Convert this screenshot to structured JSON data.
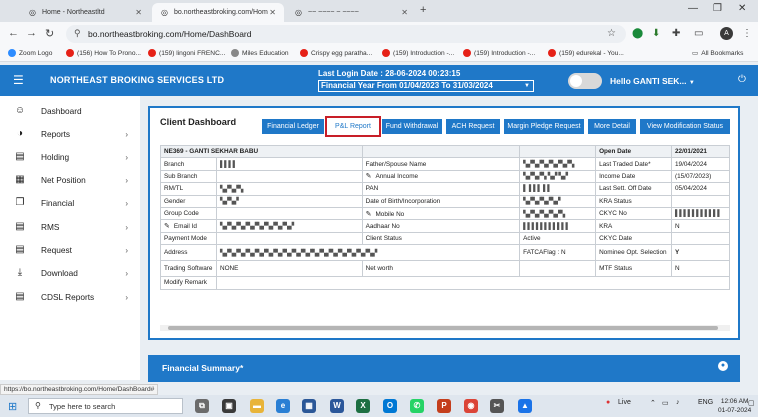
{
  "browser": {
    "tabs": [
      {
        "title": "Home - Northeastltd",
        "active": false
      },
      {
        "title": "bo.northeastbroking.com/Hom",
        "active": true
      },
      {
        "title": "~~ ~~~~ ~ ~~~~",
        "active": false
      }
    ],
    "url": "bo.northeastbroking.com/Home/DashBoard",
    "avatar_letter": "A",
    "bookmarks": [
      {
        "label": "Zoom Logo",
        "color": "#2d8cff"
      },
      {
        "label": "(156) How To Prono...",
        "color": "#e62117"
      },
      {
        "label": "(159) lingoni FRENC...",
        "color": "#e62117"
      },
      {
        "label": "Miles Education",
        "color": "#888888"
      },
      {
        "label": "Crispy egg paratha...",
        "color": "#e62117"
      },
      {
        "label": "(159) Introduction -...",
        "color": "#e62117"
      },
      {
        "label": "(159) Introduction -...",
        "color": "#e62117"
      },
      {
        "label": "(159) edurekal - You...",
        "color": "#e62117"
      }
    ],
    "all_bookmarks": "All Bookmarks"
  },
  "header": {
    "brand": "NORTHEAST BROKING SERVICES LTD",
    "last_login": "Last Login Date : 28-06-2024 00:23:15",
    "financial_year": "Financial Year From 01/04/2023 To 31/03/2024",
    "hello": "Hello GANTI SEK..."
  },
  "sidebar": {
    "items": [
      {
        "label": "Dashboard",
        "icon": "user-icon",
        "chevron": false
      },
      {
        "label": "Reports",
        "icon": "half-circle-icon",
        "chevron": true
      },
      {
        "label": "Holding",
        "icon": "list-icon",
        "chevron": true
      },
      {
        "label": "Net Position",
        "icon": "grid-icon",
        "chevron": true
      },
      {
        "label": "Financial",
        "icon": "copy-icon",
        "chevron": true
      },
      {
        "label": "RMS",
        "icon": "list-icon",
        "chevron": true
      },
      {
        "label": "Request",
        "icon": "list-icon",
        "chevron": true
      },
      {
        "label": "Download",
        "icon": "download-icon",
        "chevron": true
      },
      {
        "label": "CDSL Reports",
        "icon": "list-icon",
        "chevron": true
      }
    ]
  },
  "dashboard": {
    "title": "Client Dashboard",
    "buttons": [
      "Financial Ledger",
      "P&L Report",
      "Fund Withdrawal",
      "ACH Request",
      "Margin Pledge Request",
      "More Detail",
      "View Modification Status"
    ],
    "highlighted_button": "P&L Report",
    "client_header": "NE369 - GANTI SEKHAR BABU",
    "open_date_label": "Open Date",
    "open_date_value": "22/01/2021",
    "rows": [
      [
        "Branch",
        "▌▌▌▌",
        "Father/Spouse Name",
        "▚▞▚▞▚▞▚▞▚▞▚",
        "Last Traded Date*",
        "19/04/2024"
      ],
      [
        "Sub Branch",
        "",
        "Annual Income",
        "▚▞▚▞▚ ▚▞ ▚▞",
        "Income Date",
        "(15/07/2023)"
      ],
      [
        "RM/TL",
        "▚▞▚▞▚",
        "PAN",
        "▌ ▌▌▌ ▌▌",
        "Last Sett. Off Date",
        "05/04/2024"
      ],
      [
        "Gender",
        "▚▞▚▞",
        "Date of Birth/Incorporation",
        "▚▞▚▞▚▞▚▞",
        "KRA Status",
        ""
      ],
      [
        "Group Code",
        "",
        "Mobile No",
        "▚▞▚▞▚▞▚▞▚",
        "CKYC No",
        "▌▌▌▌▌▌▌▌▌▌▌"
      ],
      [
        "Email Id",
        "▚▞▚▞▚▞▚▞▚▞▚▞▚▞▚▞",
        "Aadhaar No",
        "▌▌▌▌▌▌▌▌▌▌▌",
        "KRA",
        "N"
      ],
      [
        "Payment Mode",
        "",
        "Client Status",
        "Active",
        "CKYC Date",
        ""
      ],
      [
        "Address",
        "▚▞▚▞▚▞▚▞▚▞▚▞▚▞▚▞▚▞▚▞▚▞▚▞▚▞▚▞▚▞▚▞▚▞",
        "",
        "FATCAFlag : N",
        "Nominee Opt. Selection",
        "Y"
      ],
      [
        "Trading Software",
        "NONE",
        "Net worth",
        "",
        "MTF Status",
        "N"
      ],
      [
        "Modify Remark",
        "",
        "",
        "",
        "",
        ""
      ]
    ]
  },
  "financial_summary": {
    "title": "Financial Summary*"
  },
  "status_url": "https://bo.northeastbroking.com/Home/DashBoard#",
  "taskbar": {
    "search_placeholder": "Type here to search",
    "weather": "Live",
    "lang": "ENG",
    "time": "12:06 AM",
    "date": "01-07-2024"
  }
}
